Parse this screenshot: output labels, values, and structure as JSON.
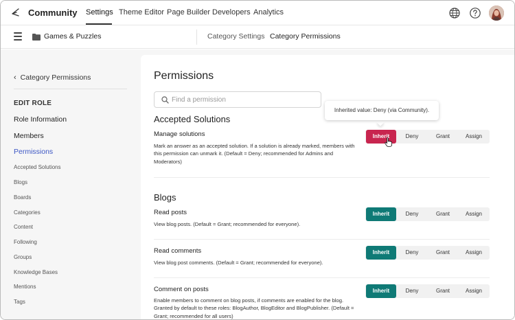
{
  "topnav": {
    "brand": "Community",
    "items": [
      "Settings",
      "Theme Editor",
      "Page Builder",
      "Developers",
      "Analytics"
    ],
    "active": "Settings",
    "icons": [
      "globe-icon",
      "help-icon",
      "avatar"
    ]
  },
  "subbar": {
    "breadcrumb": "Games & Puzzles",
    "tabs": [
      "Category Settings",
      "Category Permissions"
    ],
    "active_tab": "Category Permissions"
  },
  "sidebar": {
    "back_label": "Category Permissions",
    "heading": "EDIT ROLE",
    "main_items": [
      "Role Information",
      "Members",
      "Permissions"
    ],
    "active_item": "Permissions",
    "sub_items": [
      "Accepted Solutions",
      "Blogs",
      "Boards",
      "Categories",
      "Content",
      "Following",
      "Groups",
      "Knowledge Bases",
      "Mentions",
      "Tags"
    ]
  },
  "main": {
    "title": "Permissions",
    "search_placeholder": "Find a permission",
    "tooltip": "Inherited value: Deny (via Community).",
    "segment_labels": {
      "inherit": "Inherit",
      "deny": "Deny",
      "grant": "Grant",
      "assign": "Assign"
    },
    "sections": [
      {
        "title": "Accepted Solutions",
        "permissions": [
          {
            "name": "Manage solutions",
            "description": "Mark an answer as an accepted solution. If a solution is already marked, members with this permission can unmark it. (Default = Deny; recommended for Admins and Moderators)",
            "selected": "Inherit",
            "selected_color": "#c8254f"
          }
        ]
      },
      {
        "title": "Blogs",
        "permissions": [
          {
            "name": "Read posts",
            "description": "View blog posts. (Default = Grant; recommended for everyone).",
            "selected": "Inherit",
            "selected_color": "#0f7a76"
          },
          {
            "name": "Read comments",
            "description": "View blog post comments. (Default = Grant; recommended for everyone).",
            "selected": "Inherit",
            "selected_color": "#0f7a76"
          },
          {
            "name": "Comment on posts",
            "description": "Enable members to comment on blog posts, if comments are enabled for the blog. Granted by default to these roles: BlogAuthor, BlogEditor and BlogPublisher. (Default = Grant; recommended for all users)",
            "selected": "Inherit",
            "selected_color": "#0f7a76"
          }
        ]
      }
    ]
  },
  "colors": {
    "accent_link": "#3c56c4",
    "inherit_hover": "#c8254f",
    "inherit_default": "#0f7a76"
  }
}
